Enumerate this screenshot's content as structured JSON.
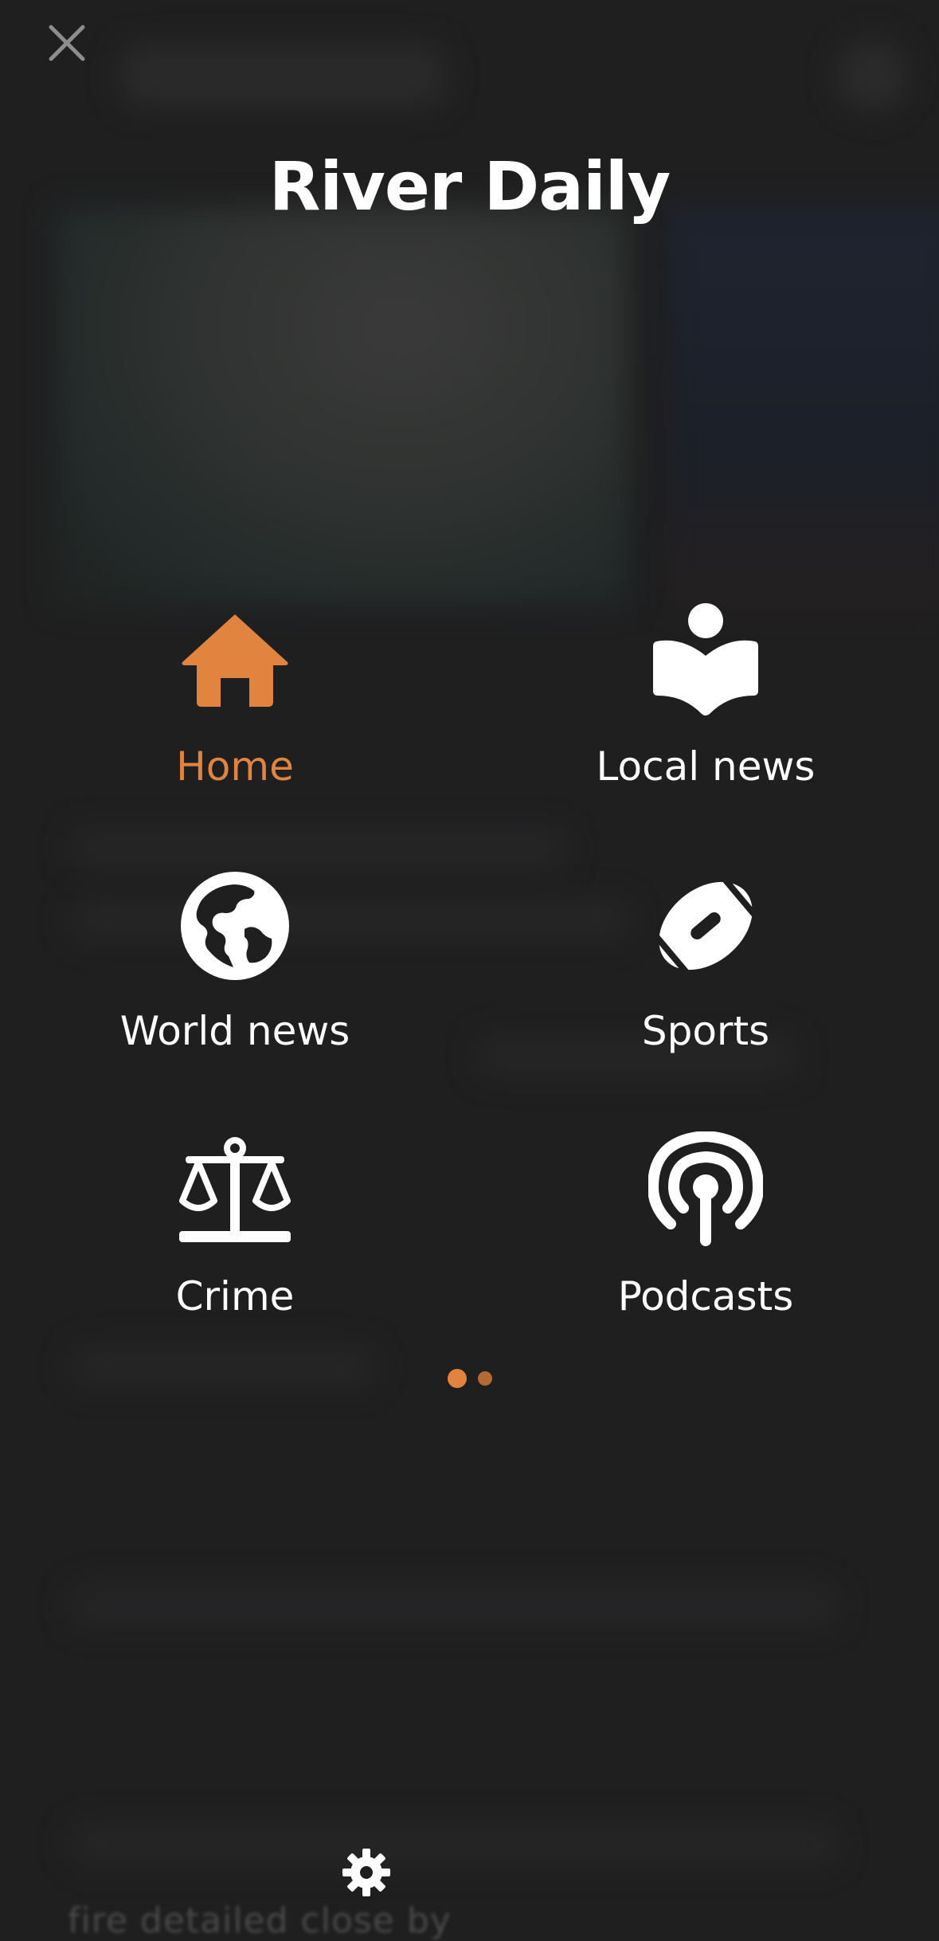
{
  "app": {
    "title": "River Daily"
  },
  "nav": {
    "items": [
      {
        "label": "Home",
        "icon": "home-icon",
        "active": true
      },
      {
        "label": "Local news",
        "icon": "reader-book-icon",
        "active": false
      },
      {
        "label": "World news",
        "icon": "globe-icon",
        "active": false
      },
      {
        "label": "Sports",
        "icon": "football-icon",
        "active": false
      },
      {
        "label": "Crime",
        "icon": "scales-icon",
        "active": false
      },
      {
        "label": "Podcasts",
        "icon": "podcast-icon",
        "active": false
      }
    ]
  },
  "pager": {
    "pages": 2,
    "current": 1
  },
  "background": {
    "footer_text": "fire detailed close by"
  },
  "colors": {
    "accent": "#e1843f",
    "background": "#1f1f20",
    "text": "#ffffff"
  }
}
